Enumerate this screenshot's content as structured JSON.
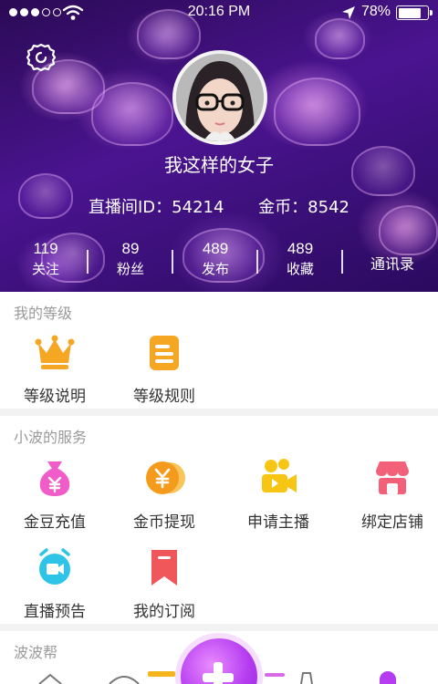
{
  "status_bar": {
    "time": "20:16 PM",
    "battery_percent": "78%",
    "battery_level": 0.78,
    "signal_bars_filled": 3,
    "signal_bars_total": 5
  },
  "profile": {
    "username": "我这样的女子",
    "room_id": "直播间ID：54214",
    "coins": "金币：8542"
  },
  "stats": [
    {
      "value": "119",
      "label": "关注"
    },
    {
      "value": "89",
      "label": "粉丝"
    },
    {
      "value": "489",
      "label": "发布"
    },
    {
      "value": "489",
      "label": "收藏"
    }
  ],
  "contacts_label": "通讯录",
  "level_section": {
    "title": "我的等级",
    "items": [
      {
        "label": "等级说明",
        "icon": "crown-icon"
      },
      {
        "label": "等级规则",
        "icon": "document-icon"
      }
    ]
  },
  "service_section": {
    "title": "小波的服务",
    "items": [
      {
        "label": "金豆充值",
        "icon": "money-bag-icon"
      },
      {
        "label": "金币提现",
        "icon": "yen-coins-icon"
      },
      {
        "label": "申请主播",
        "icon": "video-camera-icon"
      },
      {
        "label": "绑定店铺",
        "icon": "shop-icon"
      },
      {
        "label": "直播预告",
        "icon": "alarm-camera-icon"
      },
      {
        "label": "我的订阅",
        "icon": "bookmark-icon"
      }
    ]
  },
  "bobo_section": {
    "title": "波波帮"
  },
  "colors": {
    "accent_purple": "#b53cf0",
    "section_title": "#9a9a9a",
    "item_text": "#333333",
    "crown": "#f5a623",
    "document": "#f5a623",
    "money_bag": "#f05cc8",
    "yen_coin": "#f59b1c",
    "video_camera": "#f7c514",
    "shop": "#f2607a",
    "alarm": "#2ec4e8",
    "bookmark": "#f0575a"
  }
}
